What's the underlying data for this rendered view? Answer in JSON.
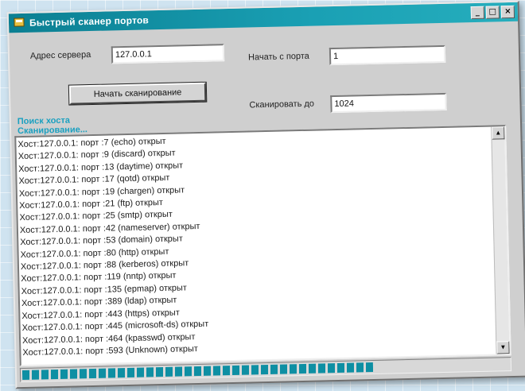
{
  "window": {
    "title": "Быстрый сканер портов",
    "buttons": {
      "minimize": "_",
      "maximize": "□",
      "close": "×"
    }
  },
  "form": {
    "server_label": "Адрес сервера",
    "server_value": "127.0.0.1",
    "start_port_label": "Начать с порта",
    "start_port_value": "1",
    "scan_to_label": "Сканировать до",
    "scan_to_value": "1024",
    "scan_button": "Начать сканирование"
  },
  "status": {
    "line1": "Поиск хоста",
    "line2": "Сканирование..."
  },
  "log": [
    "Хост:127.0.0.1: порт :7 (echo) открыт",
    "Хост:127.0.0.1: порт :9 (discard) открыт",
    "Хост:127.0.0.1: порт :13 (daytime) открыт",
    "Хост:127.0.0.1: порт :17 (qotd) открыт",
    "Хост:127.0.0.1: порт :19 (chargen) открыт",
    "Хост:127.0.0.1: порт :21 (ftp) открыт",
    "Хост:127.0.0.1: порт :25 (smtp) открыт",
    "Хост:127.0.0.1: порт :42 (nameserver) открыт",
    "Хост:127.0.0.1: порт :53 (domain) открыт",
    "Хост:127.0.0.1: порт :80 (http) открыт",
    "Хост:127.0.0.1: порт :88 (kerberos) открыт",
    "Хост:127.0.0.1: порт :119 (nntp) открыт",
    "Хост:127.0.0.1: порт :135 (epmap) открыт",
    "Хост:127.0.0.1: порт :389 (ldap) открыт",
    "Хост:127.0.0.1: порт :443 (https) открыт",
    "Хост:127.0.0.1: порт :445 (microsoft-ds) открыт",
    "Хост:127.0.0.1: порт :464 (kpasswd) открыт",
    "Хост:127.0.0.1: порт :593 (Unknown) открыт"
  ],
  "progress": {
    "fraction": 0.72,
    "color": "#0e8fa3"
  },
  "colors": {
    "titlebar": "#0b7f92",
    "status_text": "#1aa0c0",
    "window_bg": "#cfcfcf"
  },
  "icons": {
    "app": "app-icon",
    "scroll_up": "scroll-up-icon",
    "scroll_down": "scroll-down-icon"
  }
}
